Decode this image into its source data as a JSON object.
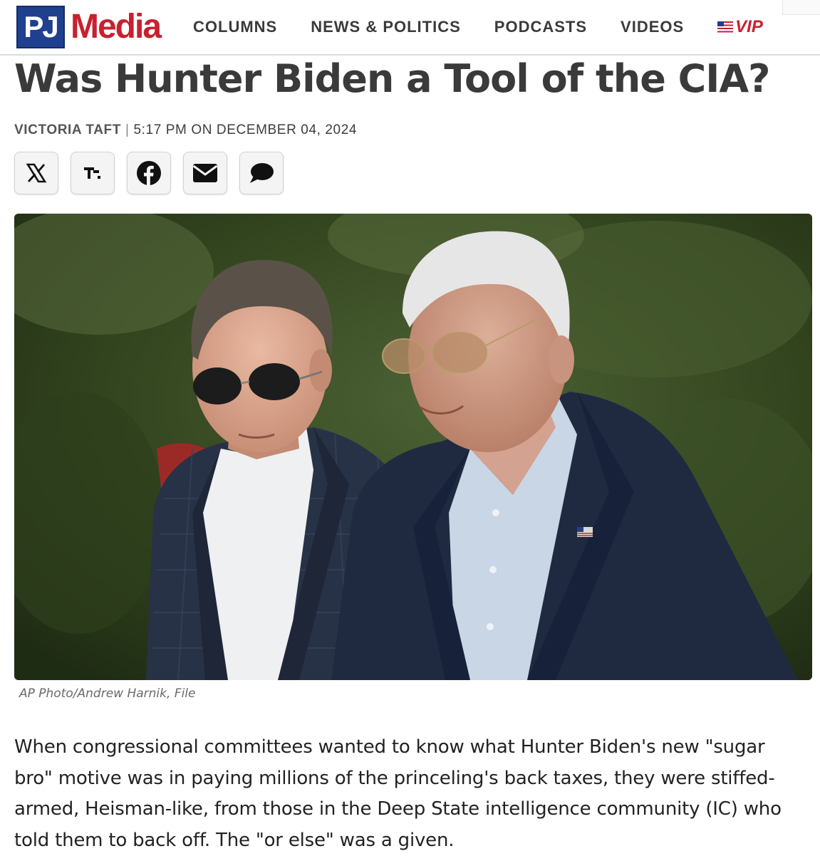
{
  "site": {
    "logo_mark": "PJ",
    "logo_word": "Media",
    "brand_colors": {
      "blue": "#1f3f8f",
      "red": "#c8202f"
    }
  },
  "nav": {
    "items": [
      {
        "label": "COLUMNS"
      },
      {
        "label": "NEWS & POLITICS"
      },
      {
        "label": "PODCASTS"
      },
      {
        "label": "VIDEOS"
      }
    ],
    "vip_label": "VIP",
    "vip_icon": "us-flag-icon"
  },
  "article": {
    "title": "Was Hunter Biden a Tool of the CIA?",
    "author": "VICTORIA TAFT",
    "separator": "|",
    "timestamp": "5:17 PM ON DECEMBER 04, 2024",
    "share_buttons": [
      {
        "icon": "x-icon"
      },
      {
        "icon": "truth-social-icon"
      },
      {
        "icon": "facebook-icon"
      },
      {
        "icon": "email-icon"
      },
      {
        "icon": "comment-icon"
      }
    ],
    "image_caption": "AP Photo/Andrew Harnik, File",
    "body": "When congressional committees wanted to know what Hunter Biden's new \"sugar bro\" motive was in paying millions of the princeling's back taxes, they were stiffed-armed, Heisman-like, from those in the Deep State intelligence community (IC) who told them to back off. The \"or else\" was a given."
  }
}
